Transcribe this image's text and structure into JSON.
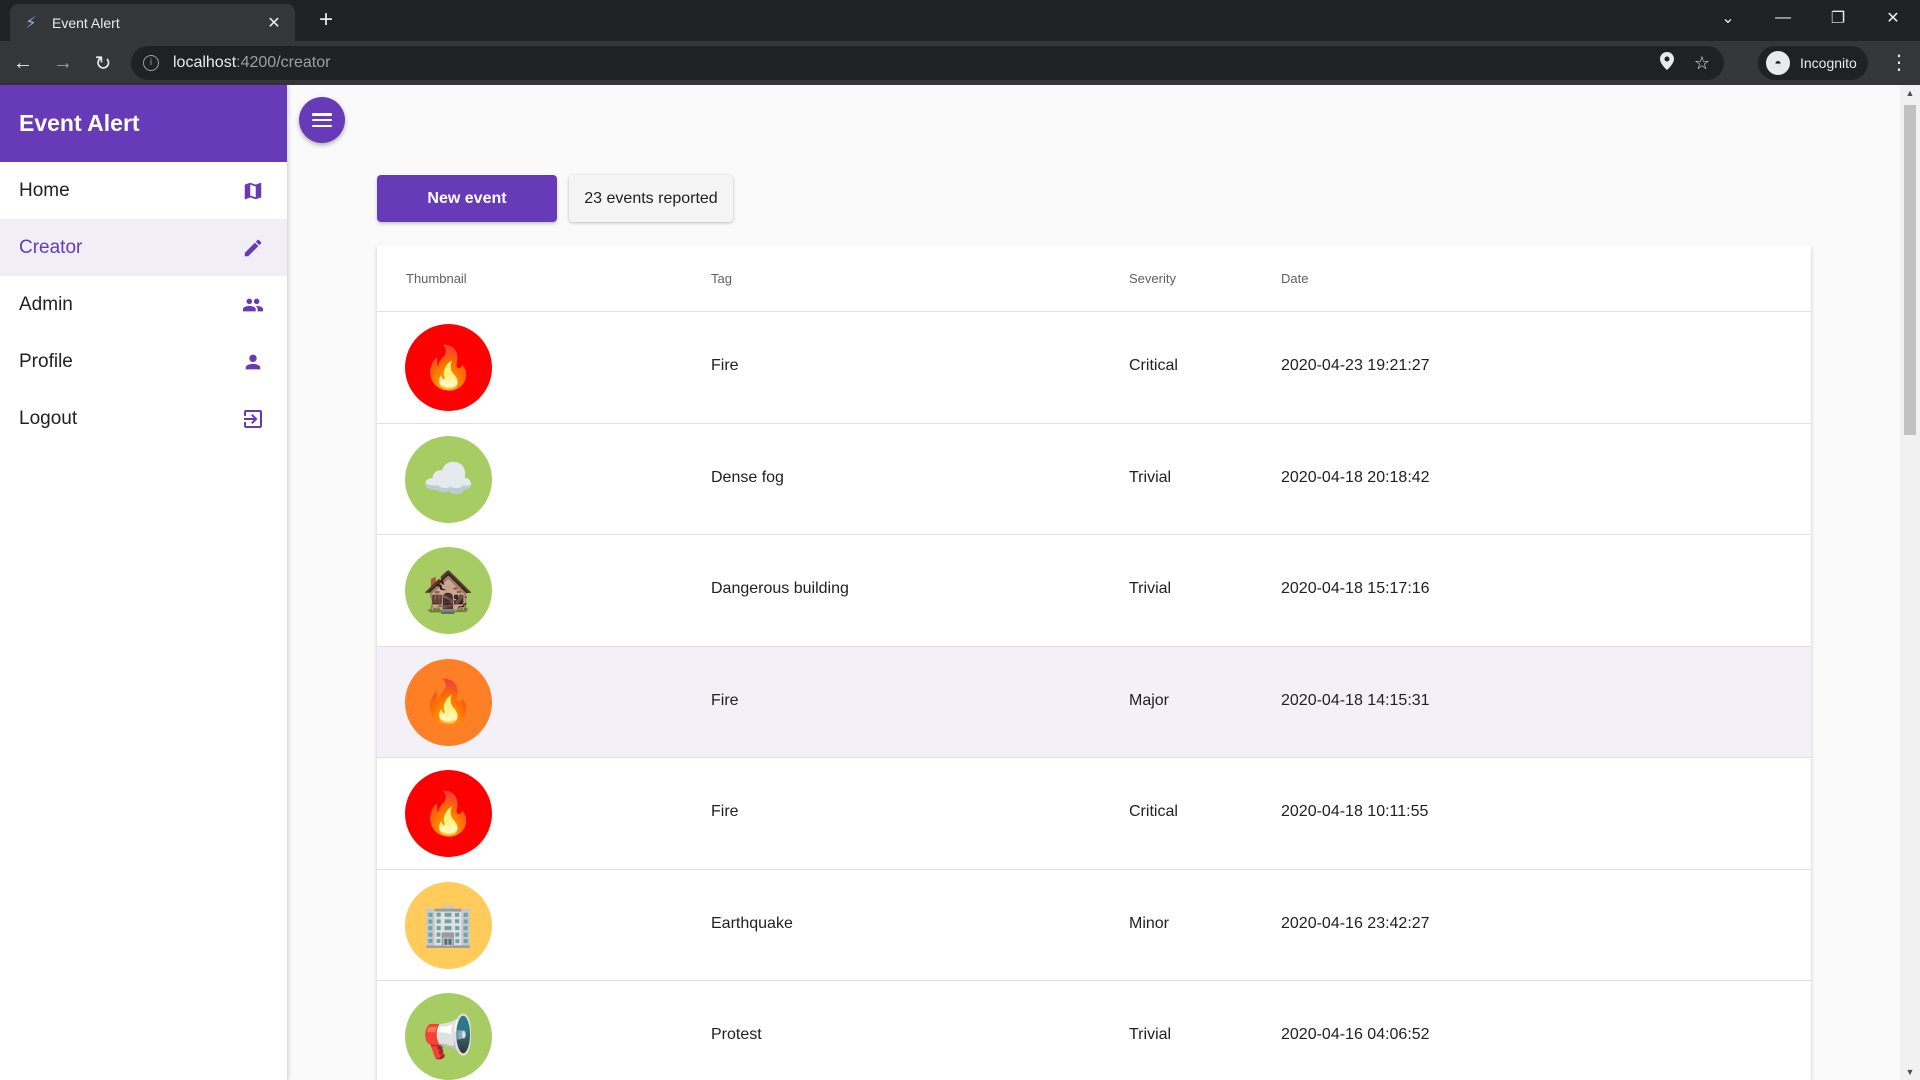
{
  "browser": {
    "tab_title": "Event Alert",
    "url_host": "localhost",
    "url_path": ":4200/creator",
    "incognito_label": "Incognito"
  },
  "app": {
    "brand": "Event Alert",
    "nav": [
      {
        "label": "Home",
        "icon": "map-icon",
        "active": false
      },
      {
        "label": "Creator",
        "icon": "pencil-icon",
        "active": true
      },
      {
        "label": "Admin",
        "icon": "group-icon",
        "active": false
      },
      {
        "label": "Profile",
        "icon": "person-icon",
        "active": false
      },
      {
        "label": "Logout",
        "icon": "logout-icon",
        "active": false
      }
    ],
    "new_event_label": "New event",
    "events_count_label": "23 events reported",
    "colors": {
      "primary": "#673ab7",
      "critical": "#f00",
      "major": "#ff7f27",
      "minor": "#ffcb5a",
      "trivial": "#a6cc63"
    }
  },
  "table": {
    "headers": {
      "thumbnail": "Thumbnail",
      "tag": "Tag",
      "severity": "Severity",
      "date": "Date"
    },
    "rows": [
      {
        "tag": "Fire",
        "severity": "Critical",
        "date": "2020-04-23 19:21:27",
        "icon": "fire-icon"
      },
      {
        "tag": "Dense fog",
        "severity": "Trivial",
        "date": "2020-04-18 20:18:42",
        "icon": "fog-icon"
      },
      {
        "tag": "Dangerous building",
        "severity": "Trivial",
        "date": "2020-04-18 15:17:16",
        "icon": "derelict-building-icon"
      },
      {
        "tag": "Fire",
        "severity": "Major",
        "date": "2020-04-18 14:15:31",
        "icon": "fire-icon"
      },
      {
        "tag": "Fire",
        "severity": "Critical",
        "date": "2020-04-18 10:11:55",
        "icon": "fire-icon"
      },
      {
        "tag": "Earthquake",
        "severity": "Minor",
        "date": "2020-04-16 23:42:27",
        "icon": "earthquake-icon"
      },
      {
        "tag": "Protest",
        "severity": "Trivial",
        "date": "2020-04-16 04:06:52",
        "icon": "megaphone-icon"
      }
    ]
  }
}
